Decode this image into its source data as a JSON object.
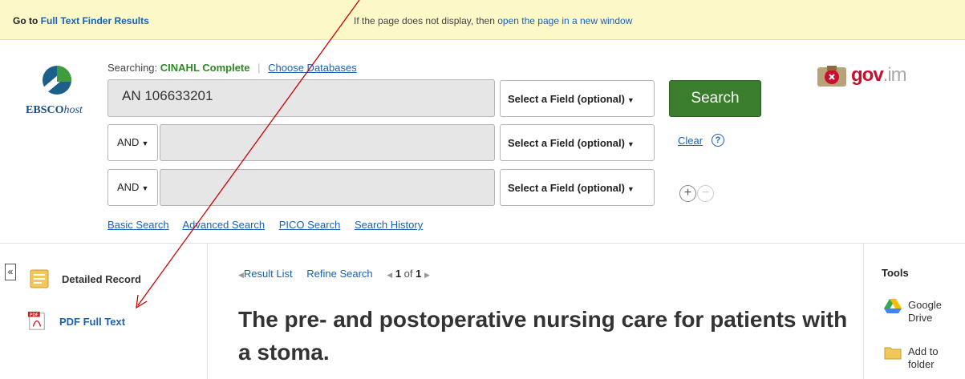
{
  "banner": {
    "goto_prefix": "Go to",
    "goto_link": "Full Text Finder Results",
    "notice_text": "If the page does not display, then",
    "notice_link": "open the page in a new window"
  },
  "logo": {
    "brand_bold": "EBSCO",
    "brand_italic": "host"
  },
  "search": {
    "searching_label": "Searching:",
    "database": "CINAHL Complete",
    "choose_databases": "Choose Databases",
    "row1_value": "AN 106633201",
    "row2_value": "",
    "row3_value": "",
    "bool2": "AND",
    "bool3": "AND",
    "field1": "Select a Field (optional)",
    "field2": "Select a Field (optional)",
    "field3": "Select a Field (optional)",
    "search_button": "Search",
    "clear": "Clear",
    "help": "?"
  },
  "search_links": [
    "Basic Search",
    "Advanced Search",
    "PICO Search",
    "Search History"
  ],
  "gov_logo": {
    "main": "gov",
    "suffix": ".im"
  },
  "left_panel": {
    "collapse": "«",
    "detailed_record": "Detailed Record",
    "pdf_full_text": "PDF Full Text"
  },
  "result_nav": {
    "result_list": "Result List",
    "refine_search": "Refine Search",
    "position": "1",
    "of_text": "of",
    "total": "1"
  },
  "record_title": "The pre- and postoperative nursing care for patients with a stoma.",
  "tools": {
    "title": "Tools",
    "google_drive_line1": "Google",
    "google_drive_line2": "Drive",
    "add_folder_line1": "Add to",
    "add_folder_line2": "folder"
  },
  "colors": {
    "banner_bg": "#fdf8c8",
    "link": "#1a61b6",
    "search_button": "#3a7d2c",
    "database_green": "#2d8a25",
    "annotation_arrow": "#cc0000"
  }
}
